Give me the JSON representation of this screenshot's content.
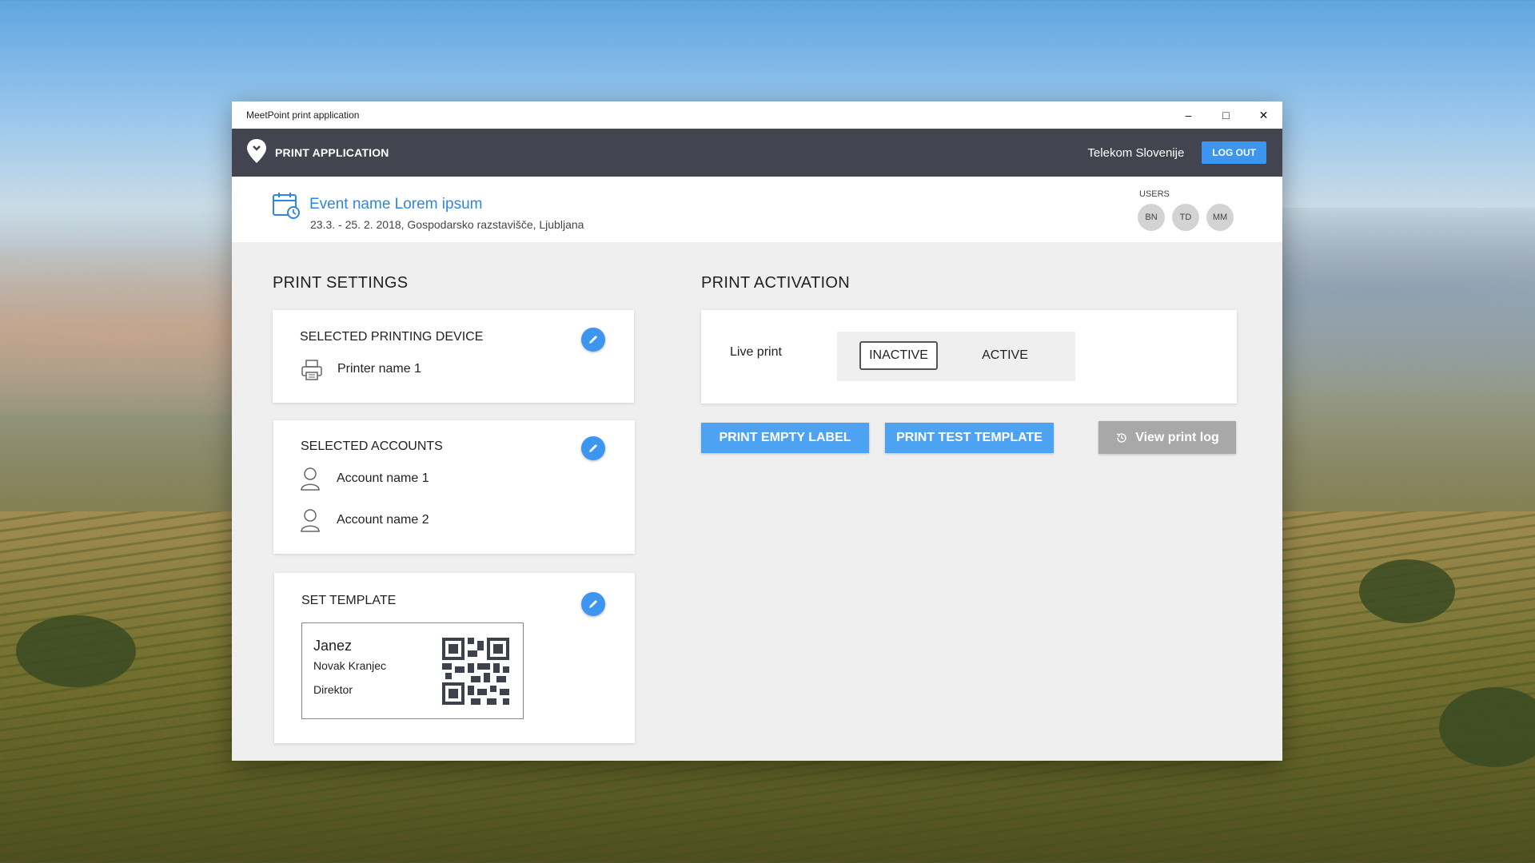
{
  "window": {
    "title": "MeetPoint print application"
  },
  "appbar": {
    "brand": "PRINT APPLICATION",
    "organization": "Telekom Slovenije",
    "logout_label": "LOG OUT"
  },
  "event": {
    "title": "Event name Lorem ipsum",
    "subtitle": "23.3. - 25. 2. 2018, Gospodarsko razstavišče, Ljubljana"
  },
  "users": {
    "label": "USERS",
    "avatars": [
      "BN",
      "TD",
      "MM"
    ]
  },
  "print_settings": {
    "title": "PRINT SETTINGS",
    "device": {
      "title": "SELECTED PRINTING DEVICE",
      "printer": "Printer name 1"
    },
    "accounts": {
      "title": "SELECTED ACCOUNTS",
      "items": [
        "Account name 1",
        "Account name 2"
      ]
    },
    "template": {
      "title": "SET TEMPLATE",
      "first_name": "Janez",
      "last_name": "Novak Kranjec",
      "position": "Direktor"
    }
  },
  "print_activation": {
    "title": "PRINT ACTIVATION",
    "live_print_label": "Live print",
    "options": [
      "INACTIVE",
      "ACTIVE"
    ],
    "selected": "INACTIVE",
    "print_empty_label": "PRINT EMPTY LABEL",
    "print_test_template": "PRINT TEST TEMPLATE",
    "view_print_log": "View print log"
  },
  "colors": {
    "accent": "#3c95ef",
    "appbar": "#42454f",
    "content_bg": "#efefef"
  }
}
